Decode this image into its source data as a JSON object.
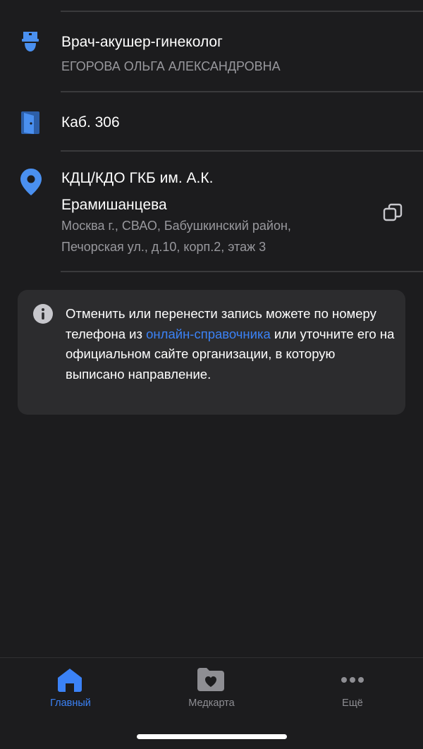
{
  "doctor": {
    "specialty": "Врач-акушер-гинеколог",
    "name": "ЕГОРОВА ОЛЬГА АЛЕКСАНДРОВНА",
    "icon": "doctor-icon"
  },
  "room": {
    "label": "Каб. 306",
    "icon": "door-icon"
  },
  "location": {
    "name_line1": "КДЦ/КДО ГКБ им. А.К.",
    "name_line2": "Ерамишанцева",
    "address_line1": "Москва г., СВАО, Бабушкинский район,",
    "address_line2": "Печорская ул., д.10, корп.2, этаж 3",
    "icon": "location-pin-icon",
    "copy_icon": "copy-icon"
  },
  "info": {
    "text_before_link": "Отменить или перенести запись можете по номеру телефона из ",
    "link_text": "онлайн-справочника",
    "text_after_link": " или уточните его на официальном сайте организации, в которую выписано направление.",
    "icon": "info-icon"
  },
  "tabbar": {
    "items": [
      {
        "label": "Главный",
        "icon": "home-icon",
        "active": true
      },
      {
        "label": "Медкарта",
        "icon": "medcard-folder-icon",
        "active": false
      },
      {
        "label": "Ещё",
        "icon": "more-dots-icon",
        "active": false
      }
    ]
  },
  "colors": {
    "background": "#1c1c1e",
    "card": "#2c2c2e",
    "accent": "#3b82f6",
    "icon_blue": "#4a90f0",
    "text_secondary": "#98989d",
    "tab_inactive": "#8e8e93"
  }
}
